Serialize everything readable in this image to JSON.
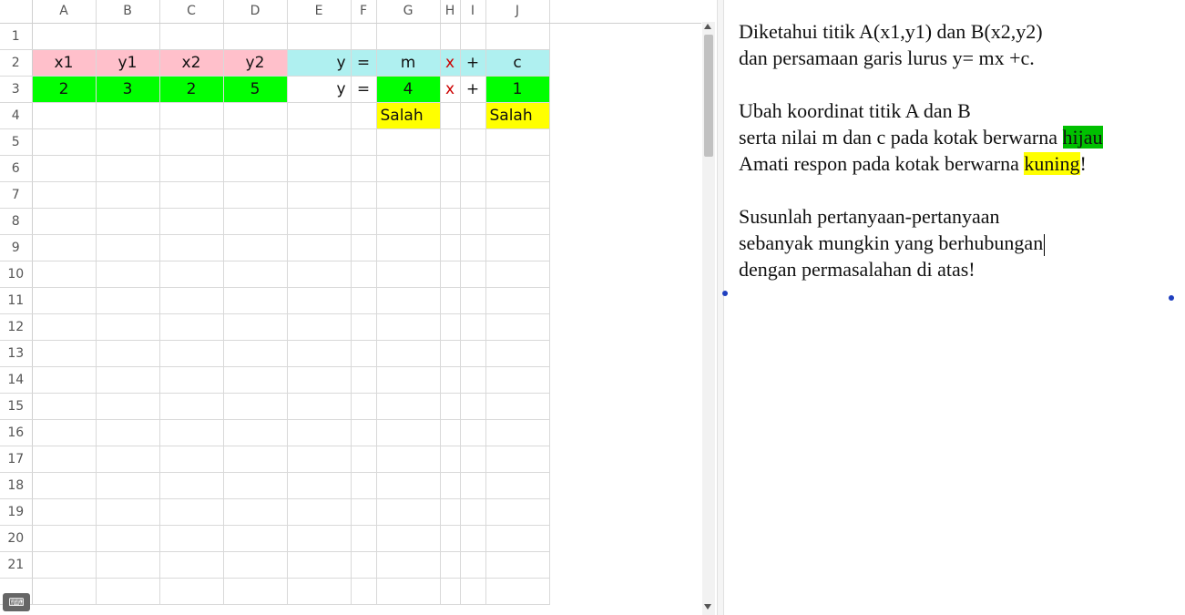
{
  "sheet": {
    "columns": [
      "A",
      "B",
      "C",
      "D",
      "E",
      "F",
      "G",
      "H",
      "I",
      "J"
    ],
    "rows": [
      "1",
      "2",
      "3",
      "4",
      "5",
      "6",
      "7",
      "8",
      "9",
      "10",
      "11",
      "12",
      "13",
      "14",
      "15",
      "16",
      "17",
      "18",
      "19",
      "20",
      "21"
    ],
    "row2": {
      "A": "x1",
      "B": "y1",
      "C": "x2",
      "D": "y2",
      "E": "y",
      "F": "=",
      "G": "m",
      "H": "x",
      "I": "+",
      "J": "c"
    },
    "row3": {
      "A": "2",
      "B": "3",
      "C": "2",
      "D": "5",
      "E": "y",
      "F": "=",
      "G": "4",
      "H": "x",
      "I": "+",
      "J": "1"
    },
    "row4": {
      "G": "Salah",
      "J": "Salah"
    },
    "colors": {
      "header_pink": "#ffc0cb",
      "header_cyan": "#aff0f0",
      "input_green": "#00ff00",
      "feedback_yellow": "#ffff00",
      "var_red": "#cc0000"
    }
  },
  "keyboard_button": {
    "icon": "keyboard-icon"
  },
  "text_panel": {
    "lines": [
      "Diketahui titik A(x1,y1) dan B(x2,y2)",
      "dan persamaan garis lurus y= mx +c.",
      "Ubah koordinat titik A dan B",
      "serta nilai m dan c pada kotak berwarna ",
      "hijau",
      "Amati respon pada kotak berwarna ",
      "kuning",
      "!",
      "Susunlah pertanyaan-pertanyaan",
      "sebanyak mungkin yang berhubungan",
      "dengan permasalahan di atas!"
    ],
    "colors": {
      "green": "#00c000",
      "yellow": "#ffff00"
    }
  }
}
